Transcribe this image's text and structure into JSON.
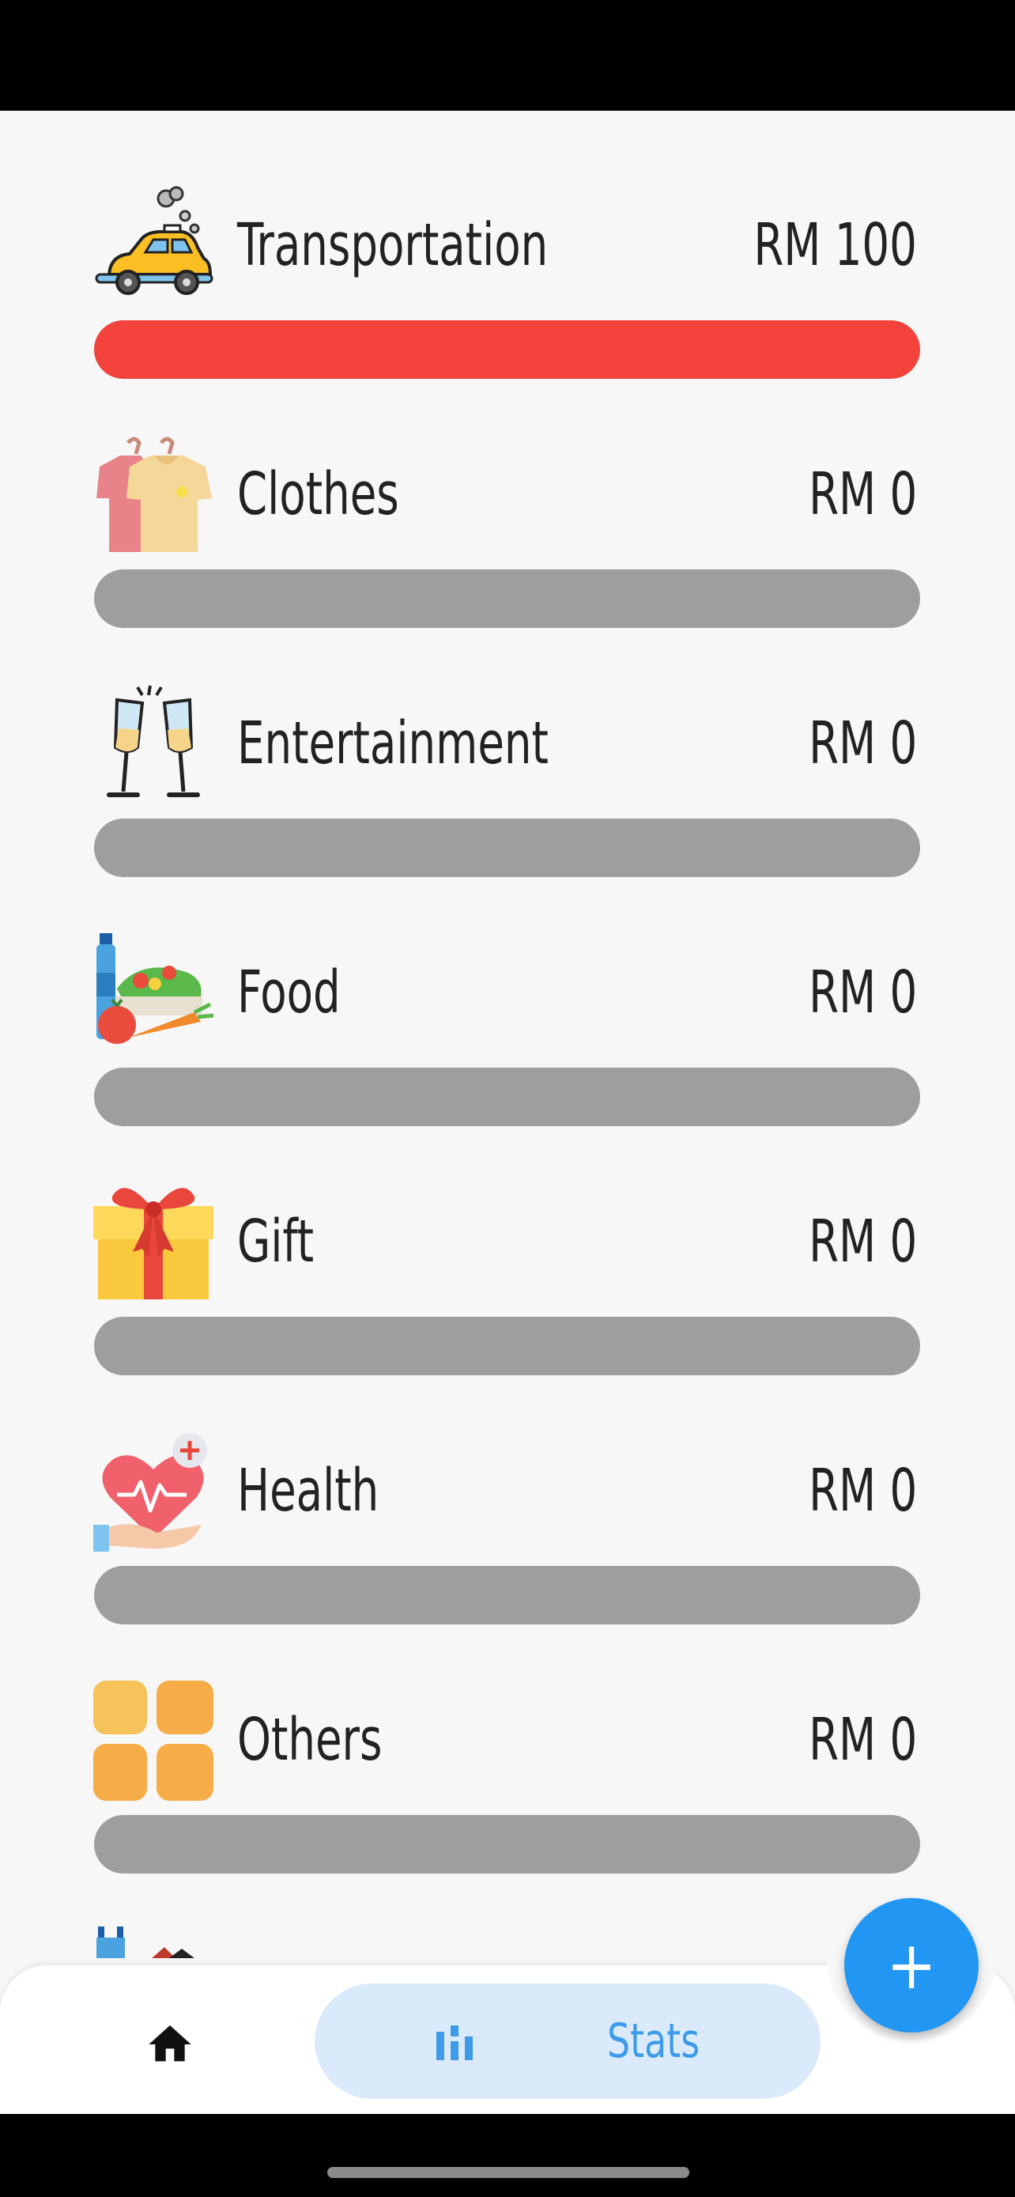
{
  "currency": "RM",
  "categories": [
    {
      "name": "Transportation",
      "amount": "RM 100",
      "progress": 1.0,
      "icon": "car-icon"
    },
    {
      "name": "Clothes",
      "amount": "RM 0",
      "progress": 0,
      "icon": "tshirt-icon"
    },
    {
      "name": "Entertainment",
      "amount": "RM 0",
      "progress": 0,
      "icon": "wine-glasses-icon"
    },
    {
      "name": "Food",
      "amount": "RM 0",
      "progress": 0,
      "icon": "groceries-icon"
    },
    {
      "name": "Gift",
      "amount": "RM 0",
      "progress": 0,
      "icon": "gift-icon"
    },
    {
      "name": "Health",
      "amount": "RM 0",
      "progress": 0,
      "icon": "heart-hand-icon"
    },
    {
      "name": "Others",
      "amount": "RM 0",
      "progress": 0,
      "icon": "grid-icon"
    }
  ],
  "nav": {
    "home_icon": "home-icon",
    "stats_label": "Stats",
    "stats_icon": "bar-chart-icon"
  },
  "fab": {
    "label": "+"
  },
  "colors": {
    "progress_fill": "#f4433c",
    "progress_track": "#9e9e9e",
    "accent": "#2196f3",
    "stats_pill_bg": "#dbeafa",
    "stats_text": "#3d9be9"
  }
}
